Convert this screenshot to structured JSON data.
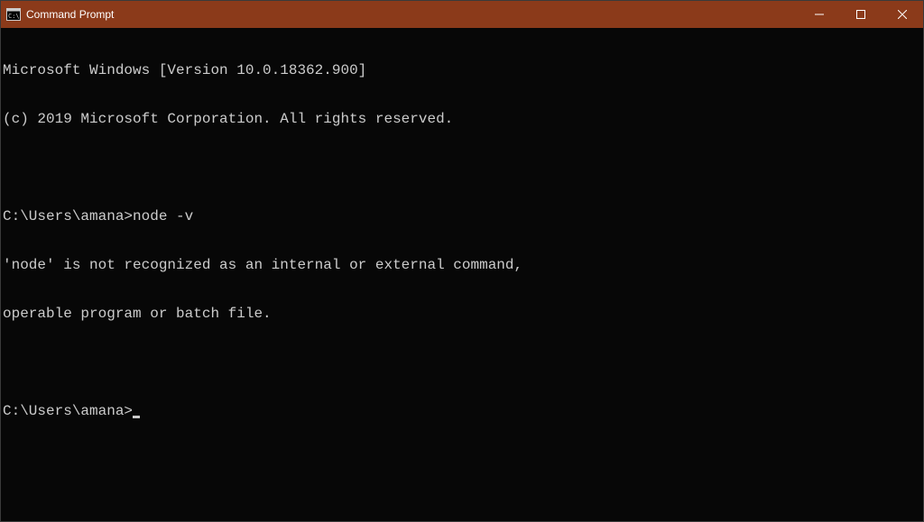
{
  "titlebar": {
    "title": "Command Prompt"
  },
  "terminal": {
    "lines": [
      "Microsoft Windows [Version 10.0.18362.900]",
      "(c) 2019 Microsoft Corporation. All rights reserved.",
      "",
      "C:\\Users\\amana>node -v",
      "'node' is not recognized as an internal or external command,",
      "operable program or batch file.",
      "",
      "C:\\Users\\amana>"
    ],
    "prompt_has_cursor": true
  },
  "colors": {
    "titlebar_bg": "#8b3a1a",
    "terminal_bg": "#070707",
    "terminal_fg": "#cccccc"
  }
}
